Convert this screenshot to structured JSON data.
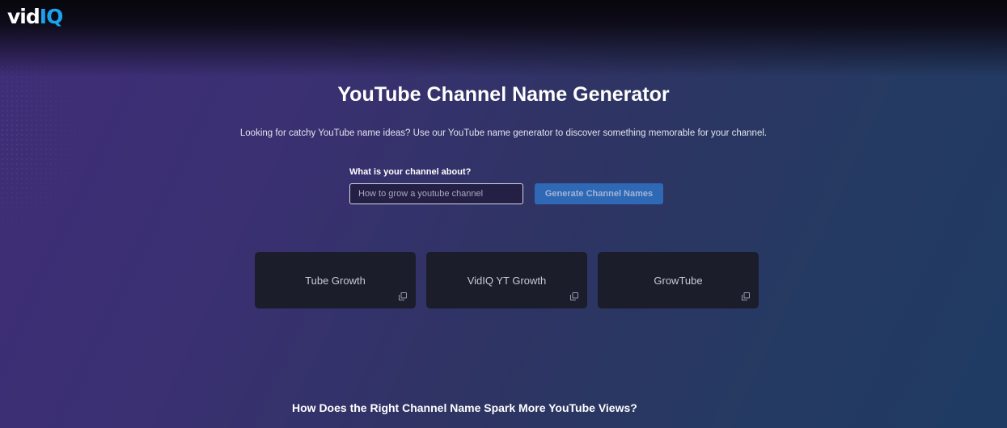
{
  "logo": {
    "part1": "vid",
    "part2": "IQ"
  },
  "page": {
    "title": "YouTube Channel Name Generator",
    "subtitle": "Looking for catchy YouTube name ideas? Use our YouTube name generator to discover something memorable for your channel."
  },
  "form": {
    "label": "What is your channel about?",
    "input_placeholder": "How to grow a youtube channel",
    "input_value": "",
    "button_label": "Generate Channel Names"
  },
  "results": [
    {
      "name": "Tube Growth",
      "icon": "copy-icon"
    },
    {
      "name": "VidIQ YT Growth",
      "icon": "copy-icon"
    },
    {
      "name": "GrowTube",
      "icon": "copy-icon"
    }
  ],
  "section": {
    "heading": "How Does the Right Channel Name Spark More YouTube Views?"
  },
  "colors": {
    "brand_blue": "#1ba3f0",
    "button_bg": "#2f68b5",
    "card_bg": "#1b1d2b"
  }
}
